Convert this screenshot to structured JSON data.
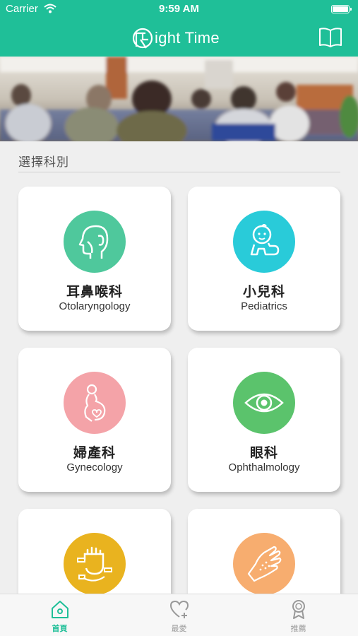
{
  "status_bar": {
    "carrier": "Carrier",
    "time": "9:59 AM"
  },
  "header": {
    "app_title": "ight Time",
    "logo_icon": "r-clock-logo-icon",
    "menu_icon": "book-icon"
  },
  "section": {
    "title": "選擇科別"
  },
  "departments": [
    {
      "zh": "耳鼻喉科",
      "en": "Otolaryngology",
      "icon": "ear-nose-throat-icon",
      "color": "#4fc89c"
    },
    {
      "zh": "小兒科",
      "en": "Pediatrics",
      "icon": "baby-icon",
      "color": "#29cbd9"
    },
    {
      "zh": "婦產科",
      "en": "Gynecology",
      "icon": "pregnant-woman-icon",
      "color": "#f4a3a8"
    },
    {
      "zh": "眼科",
      "en": "Ophthalmology",
      "icon": "eye-icon",
      "color": "#5bc36c"
    },
    {
      "zh": "",
      "en": "",
      "icon": "rehab-hand-icon",
      "color": "#e9b31f"
    },
    {
      "zh": "",
      "en": "",
      "icon": "dermatology-hand-icon",
      "color": "#f7ad6f"
    }
  ],
  "tabs": [
    {
      "label": "首頁",
      "icon": "home-icon",
      "active": true
    },
    {
      "label": "最愛",
      "icon": "heart-plus-icon",
      "active": false
    },
    {
      "label": "推薦",
      "icon": "award-ribbon-icon",
      "active": false
    }
  ],
  "colors": {
    "accent": "#1fbf98",
    "background": "#efefef"
  }
}
